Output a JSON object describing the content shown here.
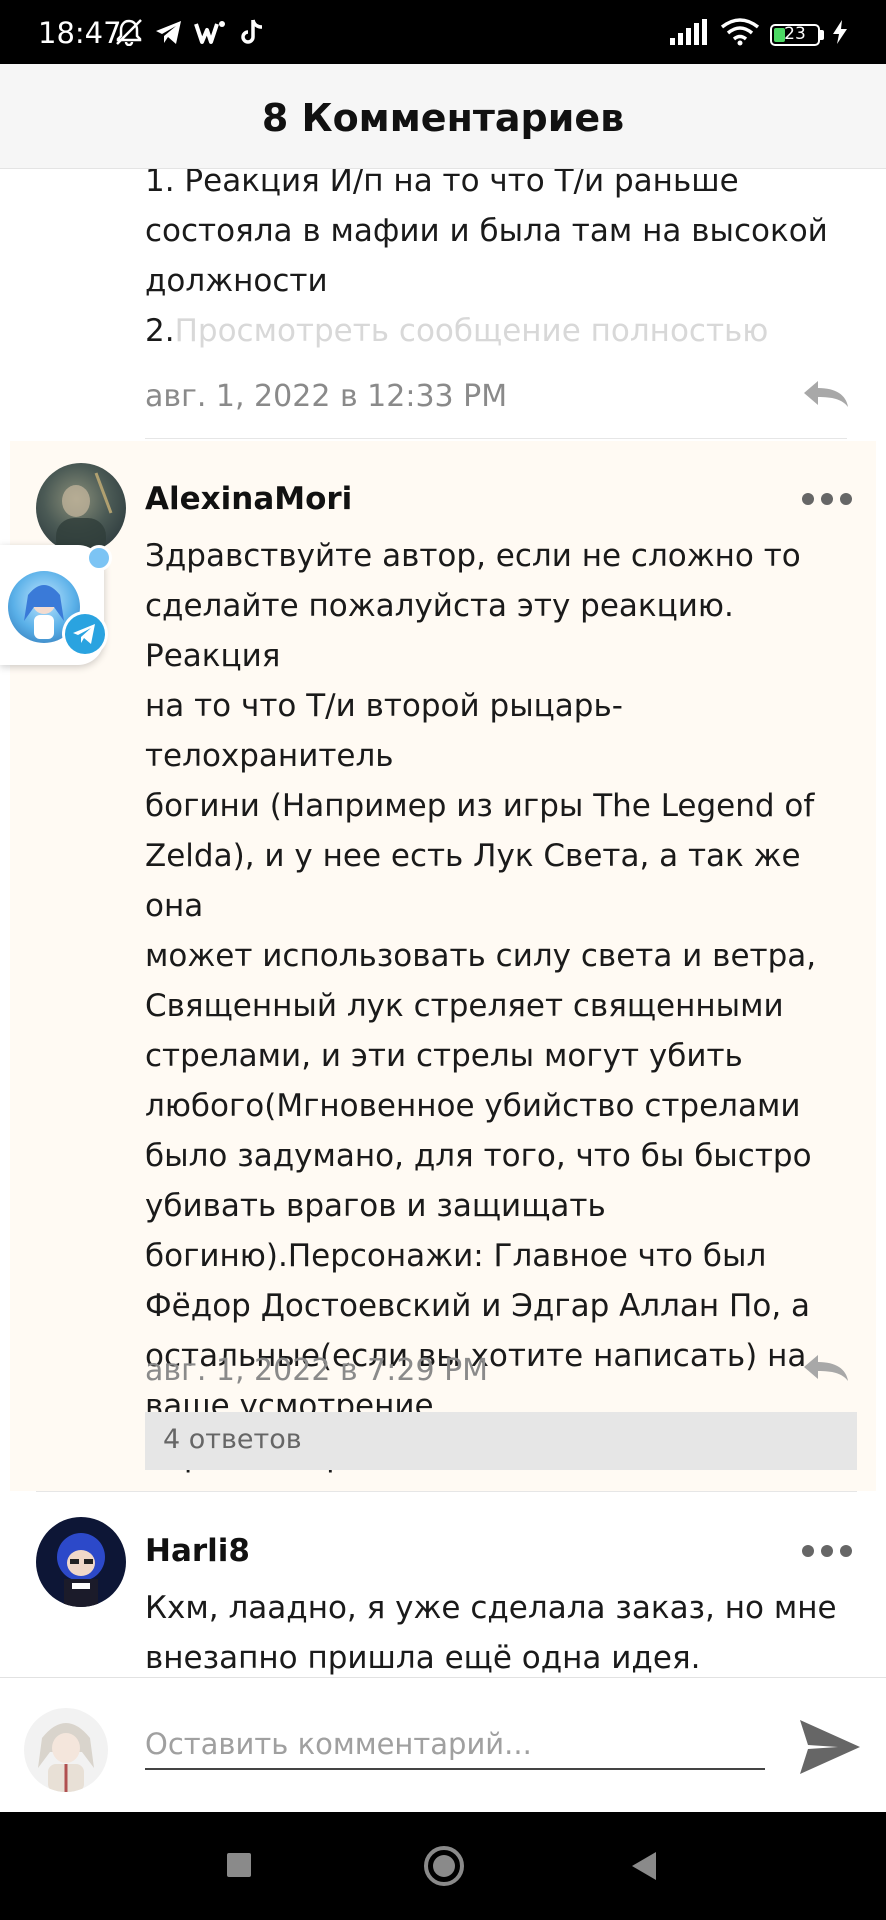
{
  "status_bar": {
    "time": "18:47",
    "battery_level": "23",
    "icons": [
      "mute-bell-icon",
      "telegram-icon",
      "w-app-icon",
      "tiktok-icon",
      "signal-icon",
      "wifi-icon",
      "battery-icon",
      "charging-icon"
    ]
  },
  "header": {
    "title": "8 Комментариев"
  },
  "comments": [
    {
      "text_lines": [
        "1. Реакция И/п на то что Т/и раньше",
        "состояла в мафии и была там на высокой",
        "должности"
      ],
      "truncated_prefix": "2.",
      "truncated_link": "Просмотреть сообщение полностью",
      "date": "авг. 1, 2022 в 12:33 PM"
    },
    {
      "username": "AlexinaMori",
      "text_lines": [
        "Здравствуйте автор, если не сложно то",
        "сделайте пожалуйста эту реакцию. Реакция",
        "на то что Т/и второй рыцарь-телохранитель",
        "богини (Например из игры The Legend of",
        "Zelda), и у нее есть Лук Света, а так же она",
        "может использовать силу света и ветра,",
        "Священный лук стреляет священными",
        "стрелами, и эти стрелы могут убить",
        "любого(Мгновенное убийство стрелами",
        "было задумано, для того, что бы быстро",
        "убивать врагов и защищать",
        "богиню).Персонажи: Главное что был",
        "Фёдор Достоевский и Эдгар Аллан По, а",
        "остальные(если вы хотите написать) на",
        "ваше усмотрение.",
        "Заранее огромное спасибо!"
      ],
      "date": "авг. 1, 2022 в 7:29 PM",
      "replies_label": "4 ответов"
    },
    {
      "username": "Harli8",
      "text_lines": [
        "Кхм, лаадно, я уже сделала заказ, но мне",
        "внезапно пришла ещё одна идея."
      ]
    }
  ],
  "comment_input": {
    "placeholder": "Оставить комментарий..."
  },
  "colors": {
    "highlight_bg": "#fffaf3",
    "date_gray": "#8a8a8a",
    "link_faded": "#d8d8d8",
    "telegram_blue": "#2aa3e0"
  }
}
